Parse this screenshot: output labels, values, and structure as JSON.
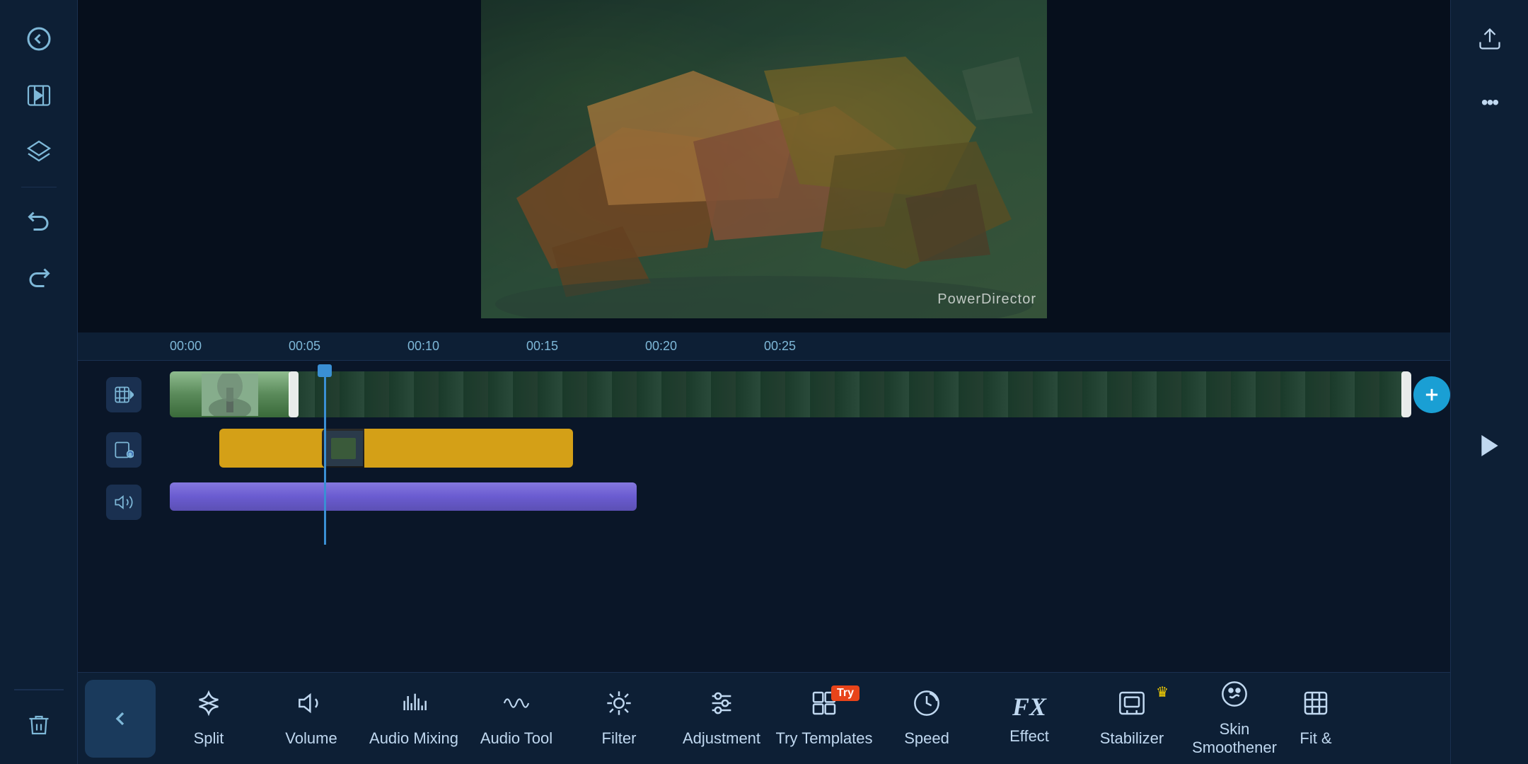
{
  "app": {
    "watermark": "PowerDirector"
  },
  "left_sidebar": {
    "icons": [
      {
        "name": "back-icon",
        "symbol": "←",
        "interactable": true
      },
      {
        "name": "media-music-icon",
        "symbol": "🎞",
        "interactable": true
      },
      {
        "name": "layers-icon",
        "symbol": "◇",
        "interactable": true
      },
      {
        "name": "undo-icon",
        "symbol": "↩",
        "interactable": true
      },
      {
        "name": "redo-icon",
        "symbol": "↪",
        "interactable": true
      },
      {
        "name": "delete-icon",
        "symbol": "🗑",
        "interactable": true
      }
    ]
  },
  "timeline": {
    "ruler_marks": [
      "00:00",
      "00:05",
      "00:10",
      "00:15",
      "00:20",
      "00:25"
    ]
  },
  "toolbar": {
    "back_label": "‹",
    "tools": [
      {
        "name": "split",
        "label": "Split",
        "icon": "✏",
        "badge": null
      },
      {
        "name": "volume",
        "label": "Volume",
        "icon": "🔊",
        "badge": null
      },
      {
        "name": "audio-mixing",
        "label": "Audio Mixing",
        "icon": "|||",
        "badge": null
      },
      {
        "name": "audio-tool",
        "label": "Audio Tool",
        "icon": "∿",
        "badge": null
      },
      {
        "name": "filter",
        "label": "Filter",
        "icon": "✿",
        "badge": null
      },
      {
        "name": "adjustment",
        "label": "Adjustment",
        "icon": "⊟",
        "badge": null
      },
      {
        "name": "templates",
        "label": "Try Templates",
        "icon": "⊞",
        "badge": "Try"
      },
      {
        "name": "speed",
        "label": "Speed",
        "icon": "⊙",
        "badge": null
      },
      {
        "name": "effect",
        "label": "Effect",
        "icon": "FX",
        "badge": null
      },
      {
        "name": "stabilizer",
        "label": "Stabilizer",
        "icon": "🖼",
        "badge": "crown"
      },
      {
        "name": "skin-smoothener",
        "label": "Skin Smoothener",
        "icon": "☺",
        "badge": null
      },
      {
        "name": "fit",
        "label": "Fit &",
        "icon": "⊡",
        "badge": null
      }
    ]
  },
  "right_sidebar": {
    "upload_label": "Upload",
    "more_label": "...",
    "play_label": "▶"
  }
}
